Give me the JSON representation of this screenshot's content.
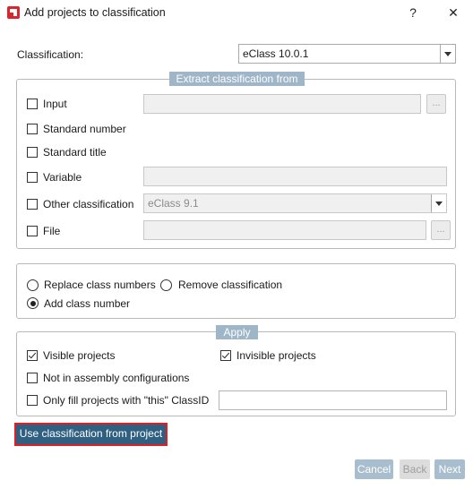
{
  "window": {
    "title": "Add projects to classification",
    "help_label": "?",
    "close_label": "✕"
  },
  "classification": {
    "label": "Classification:",
    "selected": "eClass 10.0.1"
  },
  "extract": {
    "legend": "Extract classification from",
    "input_label": "Input",
    "standard_number_label": "Standard number",
    "standard_title_label": "Standard title",
    "variable_label": "Variable",
    "other_classification_label": "Other classification",
    "other_classification_value": "eClass 9.1",
    "file_label": "File",
    "browse_label": "..."
  },
  "mode": {
    "replace_label": "Replace class numbers",
    "remove_label": "Remove classification",
    "add_label": "Add class number"
  },
  "apply": {
    "legend": "Apply",
    "visible_label": "Visible projects",
    "invisible_label": "Invisible projects",
    "not_assembly_label": "Not in assembly configurations",
    "only_fill_label": "Only fill projects with \"this\" ClassID"
  },
  "actions": {
    "use_from_project_label": "Use classification from project",
    "cancel_label": "Cancel",
    "back_label": "Back",
    "next_label": "Next"
  },
  "colors": {
    "accent": "#2f5f81",
    "legend_bg": "#9eb6c8",
    "highlight_frame": "#e01e24"
  }
}
